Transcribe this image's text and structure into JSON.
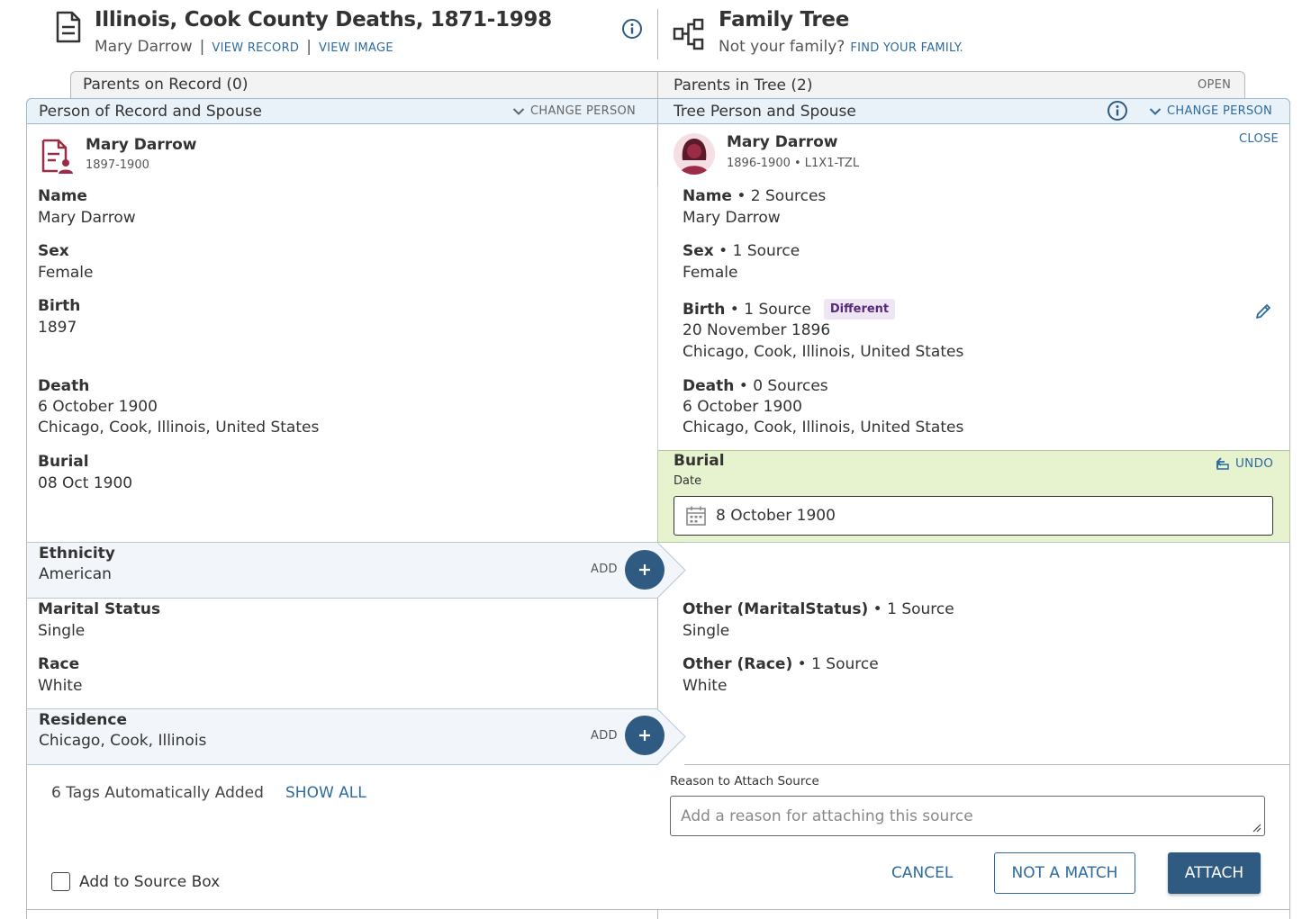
{
  "record": {
    "title": "Illinois, Cook County Deaths, 1871-1998",
    "person_name": "Mary Darrow",
    "view_record": "VIEW RECORD",
    "view_image": "VIEW IMAGE",
    "separator": "|"
  },
  "tree": {
    "title": "Family Tree",
    "not_your_family": "Not your family?",
    "find_family": "FIND YOUR FAMILY."
  },
  "tabs": {
    "left": "Parents on Record (0)",
    "right": "Parents in Tree (2)",
    "right_action": "OPEN"
  },
  "left_header": {
    "label": "Person of Record and Spouse",
    "action": "CHANGE PERSON"
  },
  "right_header": {
    "label": "Tree Person and Spouse",
    "action": "CHANGE PERSON"
  },
  "left_person": {
    "name": "Mary Darrow",
    "dates": "1897-1900",
    "fields": {
      "name": {
        "label": "Name",
        "value": "Mary Darrow"
      },
      "sex": {
        "label": "Sex",
        "value": "Female"
      },
      "birth": {
        "label": "Birth",
        "value": "1897"
      },
      "death": {
        "label": "Death",
        "date": "6 October 1900",
        "place": "Chicago, Cook, Illinois, United States"
      },
      "burial": {
        "label": "Burial",
        "value": "08 Oct 1900"
      },
      "ethnicity": {
        "label": "Ethnicity",
        "value": "American",
        "add": "ADD"
      },
      "marital": {
        "label": "Marital Status",
        "value": "Single"
      },
      "race": {
        "label": "Race",
        "value": "White"
      },
      "residence": {
        "label": "Residence",
        "value": "Chicago, Cook, Illinois",
        "add": "ADD"
      }
    }
  },
  "right_person": {
    "name": "Mary Darrow",
    "dates": "1896-1900 • L1X1-TZL",
    "close": "CLOSE",
    "bullet": " • ",
    "fields": {
      "name": {
        "label": "Name",
        "sources": "2 Sources",
        "value": "Mary Darrow"
      },
      "sex": {
        "label": "Sex",
        "sources": "1 Source",
        "value": "Female"
      },
      "birth": {
        "label": "Birth",
        "sources": "1 Source",
        "badge": "Different",
        "date": "20 November 1896",
        "place": "Chicago, Cook, Illinois, United States"
      },
      "death": {
        "label": "Death",
        "sources": "0 Sources",
        "date": "6 October 1900",
        "place": "Chicago, Cook, Illinois, United States"
      },
      "burial": {
        "label": "Burial",
        "sublabel": "Date",
        "undo": "UNDO",
        "date_value": "8 October 1900"
      },
      "marital": {
        "label": "Other (MaritalStatus)",
        "sources": "1 Source",
        "value": "Single"
      },
      "race": {
        "label": "Other (Race)",
        "sources": "1 Source",
        "value": "White"
      }
    }
  },
  "footer": {
    "tags_text": "6 Tags Automatically Added",
    "show_all": "SHOW ALL",
    "source_box_label": "Add to Source Box",
    "reason_label": "Reason to Attach Source",
    "reason_placeholder": "Add a reason for attaching this source",
    "cancel": "CANCEL",
    "not_a_match": "NOT A MATCH",
    "attach": "ATTACH"
  },
  "colors": {
    "link": "#2d6a9f",
    "primary_button": "#2f5b82",
    "header_bar": "#eaf2f9",
    "edited_burial": "#e7f2cf",
    "different_badge": "#efe6f3",
    "record_icon": "#9b2c46"
  }
}
